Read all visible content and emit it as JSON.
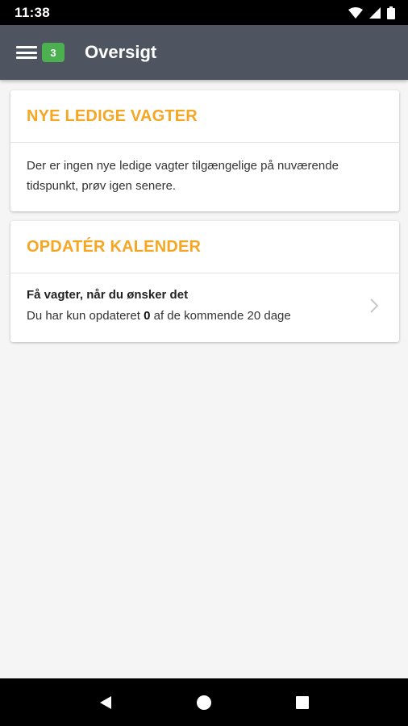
{
  "status_bar": {
    "time": "11:38",
    "icons": [
      "wifi-icon",
      "signal-icon",
      "battery-icon"
    ]
  },
  "app_bar": {
    "title": "Oversigt",
    "badge_count": "3",
    "menu_icon": "hamburger-menu-icon"
  },
  "cards": {
    "new_shifts": {
      "title": "NYE LEDIGE VAGTER",
      "message": "Der er ingen nye ledige vagter tilgængelige på nuværende tidspunkt, prøv igen senere."
    },
    "update_calendar": {
      "title": "OPDATÉR KALENDER",
      "row_title": "Få vagter, når du ønsker det",
      "row_sub_prefix": "Du har kun opdateret ",
      "row_sub_count": "0",
      "row_sub_suffix": " af de kommende 20 dage",
      "chevron_icon": "chevron-right-icon"
    }
  },
  "nav_bar": {
    "buttons": [
      "back-icon",
      "home-icon",
      "recents-icon"
    ]
  },
  "colors": {
    "app_bar": "#4e5561",
    "accent": "#f5a623",
    "badge": "#4caf50",
    "background": "#f5f5f5"
  }
}
